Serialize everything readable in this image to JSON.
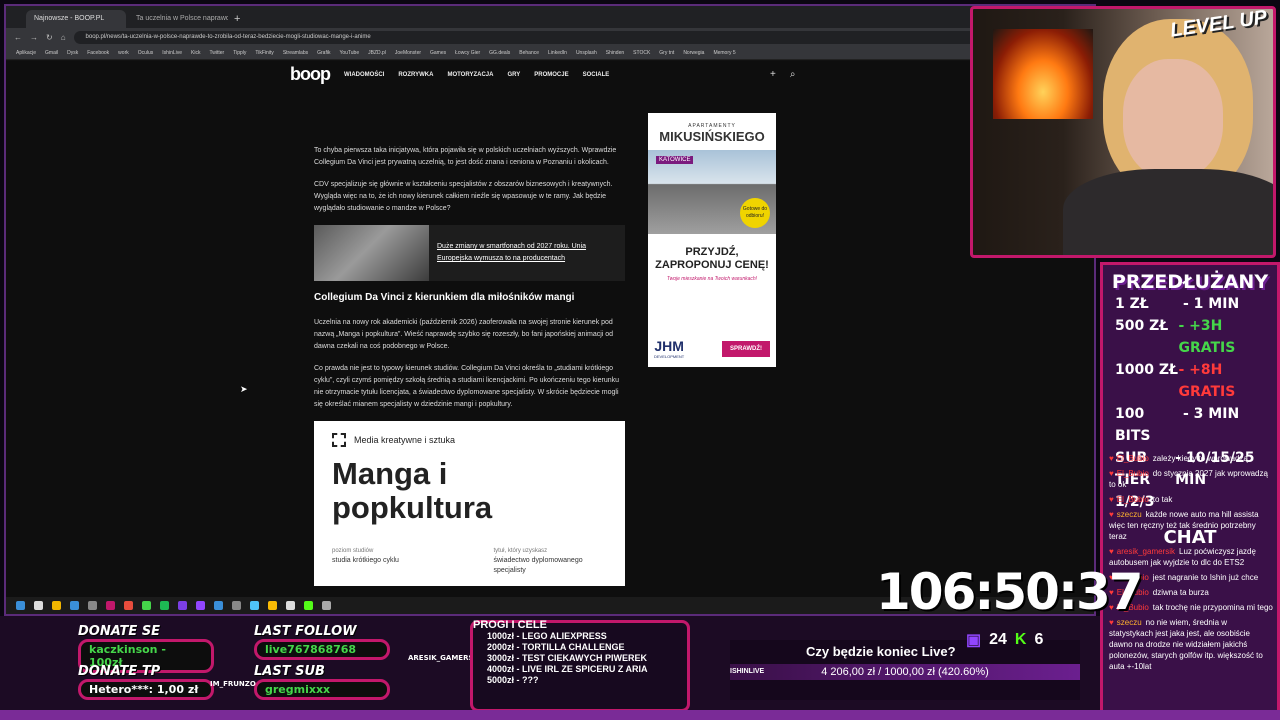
{
  "browser": {
    "tabs": [
      "Najnowsze - BOOP.PL",
      "Ta uczelnia w Polsce naprawdę"
    ],
    "new_tab": "+",
    "url": "boop.pl/news/ta-uczelnia-w-polsce-naprawde-to-zrobila-od-teraz-bedziecie-mogli-studiowac-mange-i-anime",
    "bookmarks": [
      "Aplikacje",
      "Gmail",
      "Dysk",
      "Facebook",
      "work",
      "Oculus",
      "IshinLive",
      "Kick",
      "Twitter",
      "Tipply",
      "TikFinity",
      "Streamlabs",
      "Grafik",
      "YouTube",
      "JBZD.pl",
      "JoeMonster",
      "Games",
      "Łowcy Gier",
      "GG.deals",
      "Behance",
      "LinkedIn",
      "Unsplash",
      "Shinden",
      "STOCK",
      "Gry tnt",
      "Norwegia",
      "Memory 5"
    ]
  },
  "site": {
    "logo": "boop",
    "menu": [
      "WIADOMOŚCI",
      "ROZRYWKA",
      "MOTORYZACJA",
      "GRY",
      "PROMOCJE",
      "SOCIALE"
    ],
    "article": {
      "p1": "To chyba pierwsza taka inicjatywa, która pojawiła się w polskich uczelniach wyższych. Wprawdzie Collegium Da Vinci jest prywatną uczelnią, to jest dość znana i ceniona w Poznaniu i okolicach.",
      "p2": "CDV specjalizuje się głównie w kształceniu specjalistów z obszarów biznesowych i kreatywnych. Wygląda więc na to, że ich nowy kierunek całkiem nieźle się wpasowuje w te ramy. Jak będzie wyglądało studiowanie o mandze w Polsce?",
      "promo": "Duże zmiany w smartfonach od 2027 roku. Unia Europejska wymusza to na producentach",
      "heading": "Collegium Da Vinci z kierunkiem dla miłośników mangi",
      "p3": "Uczelnia na nowy rok akademicki (październik 2026) zaoferowała na swojej stronie kierunek pod nazwą „Manga i popkultura”. Wieść naprawdę szybko się rozeszły, bo fani japońskiej animacji od dawna czekali na coś podobnego w Polsce.",
      "p4": "Co prawda nie jest to typowy kierunek studiów. Collegium Da Vinci określa to „studiami krótkiego cyklu”, czyli czymś pomiędzy szkołą średnią a studiami licencjackimi. Po ukończeniu tego kierunku nie otrzymacie tytułu licencjata, a świadectwo dyplomowane specjalisty. W skrócie będziecie mogli się określać mianem specjalisty w dziedzinie mangi i popkultury.",
      "card": {
        "category": "Media kreatywne i sztuka",
        "title": "Manga i popkultura",
        "level_label": "poziom studiów",
        "level_value": "studia krótkiego cyklu",
        "degree_label": "tytuł, który uzyskasz",
        "degree_value": "świadectwo dyplomowanego specjalisty"
      }
    },
    "ad": {
      "top": "APARTAMENTY",
      "brand": "MIKUSIŃSKIEGO",
      "city": "KATOWICE",
      "badge": "Gotowe do odbioru!",
      "headline": "PRZYJDŹ, ZAPROPONUJ CENĘ!",
      "sub": "Twoje mieszkanie na Twoich warunkach!",
      "logo": "JHM",
      "logo_sub": "DEVELOPMENT",
      "button": "SPRAWDŹ!"
    }
  },
  "overlay": {
    "levelup": "LEVEL UP",
    "extension_title": "PRZEDŁUŻANY",
    "prices": [
      {
        "amount": "1 ZŁ",
        "value": "- 1 MIN",
        "style": "w"
      },
      {
        "amount": "500 ZŁ",
        "value": "- +3H GRATIS",
        "style": "g"
      },
      {
        "amount": "1000 ZŁ",
        "value": "- +8H GRATIS",
        "style": "r"
      },
      {
        "amount": "100 BITS",
        "value": "- 3 MIN",
        "style": "w"
      },
      {
        "amount": "SUB TIER 1/2/3",
        "value": "- 10/15/25 MIN",
        "style": "w"
      }
    ],
    "chat_title": "CHAT",
    "chat": [
      {
        "user": "El_Bubio",
        "text": "zależy kiedy to wprowadzą"
      },
      {
        "user": "El_Bubio",
        "text": "do stycznia 2027 jak wprowadzą to ok"
      },
      {
        "user": "El_Bubio",
        "text": "to tak"
      },
      {
        "user": "szeczu",
        "text": "każde nowe auto ma hill assista więc ten ręczny też tak średnio potrzebny teraz"
      },
      {
        "user": "aresik_gamersik",
        "text": "Luz poćwiczysz jazdę autobusem jak wyjdzie to dlc do ETS2"
      },
      {
        "user": "El_Bubio",
        "text": "jest nagranie to Ishin już chce"
      },
      {
        "user": "El_Bubio",
        "text": "dziwna ta burza"
      },
      {
        "user": "El_Bubio",
        "text": "tak trochę nie przypomina mi tego"
      },
      {
        "user": "szeczu",
        "text": "no nie wiem, średnia w statystykach jest jaka jest, ale osobiście dawno na drodze nie widziałem jakichś polonezów, starych golfów itp. większość to auta +-10lat"
      }
    ],
    "timer": "106:50:37",
    "donate_se_label": "DONATE SE",
    "donate_se_value": "kaczkinson - 100zł",
    "donate_tp_label": "DONATE TP",
    "donate_tp_value": "Hetero***: 1,00 zł",
    "last_follow_label": "LAST FOLLOW",
    "last_follow_value": "live767868768",
    "last_sub_label": "LAST SUB",
    "last_sub_value": "gregmixxx",
    "goals_title": "PROGI I CELE",
    "goals": [
      "1000zł - LEGO ALIEXPRESS",
      "2000zł - TORTILLA CHALLENGE",
      "3000zł - TEST CIEKAWYCH PIWEREK",
      "4000zł - LIVE IRL ZE SPICERU Z ARIA",
      "5000zł - ???"
    ],
    "goal_tag": "ARESIK_GAMERSIK",
    "im_tag": "IM_FRUNZO",
    "donation_question": "Czy będzie koniec Live?",
    "donation_progress": "4 206,00 zł / 1000,00 zł (420.60%)",
    "donation_tag": "ISHINLIVE",
    "twitch_count": "24",
    "kick_count": "6"
  }
}
